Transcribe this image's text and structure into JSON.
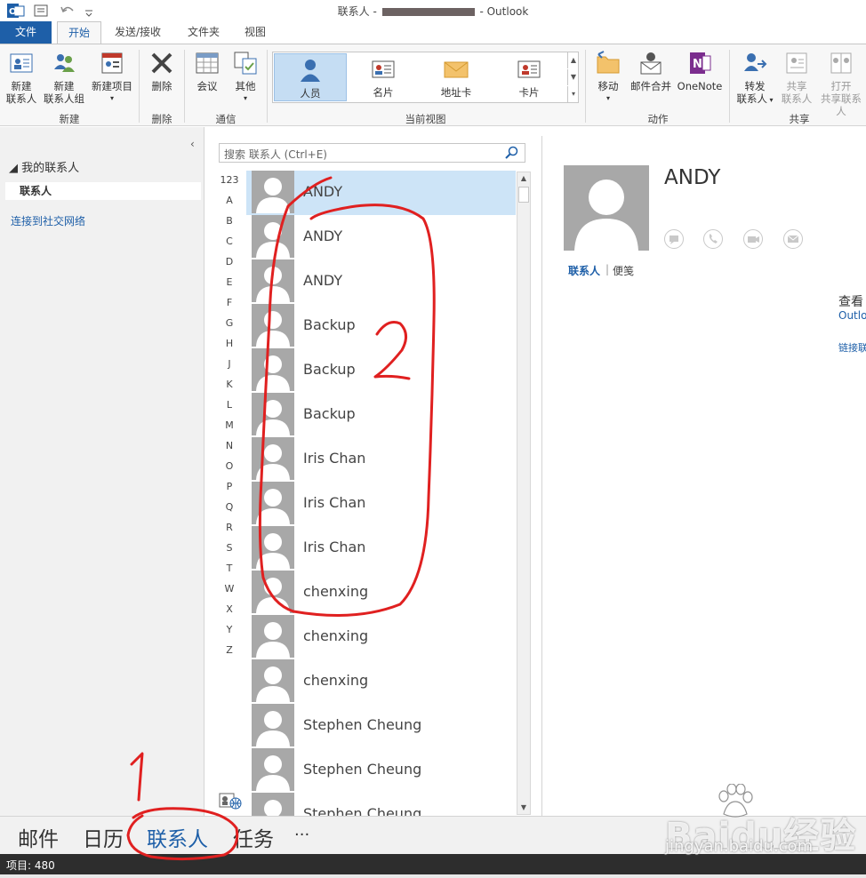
{
  "window": {
    "title_prefix": "联系人 -",
    "title_suffix": "- Outlook"
  },
  "quick_access": [
    "outlook-app-icon",
    "send-receive-icon",
    "undo-icon",
    "customize-dropdown-icon"
  ],
  "tabs": [
    {
      "label": "文件"
    },
    {
      "label": "开始"
    },
    {
      "label": "发送/接收"
    },
    {
      "label": "文件夹"
    },
    {
      "label": "视图"
    }
  ],
  "ribbon": {
    "new_group": {
      "label": "新建",
      "new_contact": [
        "新建",
        "联系人"
      ],
      "new_contact_group": [
        "新建",
        "联系人组"
      ],
      "new_items": "新建项目"
    },
    "delete_group": {
      "label": "删除",
      "delete": "删除"
    },
    "communicate_group": {
      "label": "通信",
      "meeting": "会议",
      "more": "其他"
    },
    "current_view_group": {
      "label": "当前视图",
      "views": [
        "人员",
        "名片",
        "地址卡",
        "卡片"
      ],
      "selected": "人员"
    },
    "actions_group": {
      "label": "动作",
      "move": "移动",
      "mail_merge": "邮件合并",
      "onenote": "OneNote"
    },
    "share_group": {
      "label": "共享",
      "forward": [
        "转发",
        "联系人"
      ],
      "share": [
        "共享",
        "联系人"
      ],
      "open": [
        "打开",
        "共享联系人"
      ]
    }
  },
  "folder_pane": {
    "my_contacts": "◢ 我的联系人",
    "contacts_folder": "联系人",
    "connect_social": "连接到社交网络",
    "collapse_glyph": "‹"
  },
  "list_pane": {
    "search_placeholder": "搜索 联系人 (Ctrl+E)",
    "alphabet": [
      "123",
      "A",
      "B",
      "C",
      "D",
      "E",
      "F",
      "G",
      "H",
      "J",
      "K",
      "L",
      "M",
      "N",
      "O",
      "P",
      "Q",
      "R",
      "S",
      "T",
      "W",
      "X",
      "Y",
      "Z"
    ],
    "contacts": [
      {
        "name": "ANDY",
        "selected": true
      },
      {
        "name": "ANDY"
      },
      {
        "name": "ANDY"
      },
      {
        "name": "Backup"
      },
      {
        "name": "Backup"
      },
      {
        "name": "Backup"
      },
      {
        "name": "Iris Chan"
      },
      {
        "name": "Iris Chan"
      },
      {
        "name": "Iris Chan"
      },
      {
        "name": "chenxing"
      },
      {
        "name": "chenxing"
      },
      {
        "name": "chenxing"
      },
      {
        "name": "Stephen Cheung"
      },
      {
        "name": "Stephen Cheung"
      },
      {
        "name": "Stephen Cheung"
      }
    ]
  },
  "reading_pane": {
    "name": "ANDY",
    "action_icons": [
      "im-icon",
      "phone-icon",
      "video-icon",
      "email-icon"
    ],
    "tab_contact": "联系人",
    "tab_notes": "便笺",
    "see_more": "查看",
    "outlook_link": "Outlo",
    "link_text": "链接联"
  },
  "nav": {
    "items": [
      "邮件",
      "日历",
      "联系人",
      "任务",
      "···"
    ],
    "active": "联系人"
  },
  "status": {
    "items": "项目: 480"
  },
  "watermark": {
    "logo": "Baidu经验",
    "url": "jingyan.baidu.com"
  },
  "annotations": {
    "one": "1",
    "two": "2",
    "color": "#e02020"
  },
  "colors": {
    "accent": "#1e5fa8",
    "selection": "#cde4f7",
    "statusbar": "#2d2d2d"
  }
}
